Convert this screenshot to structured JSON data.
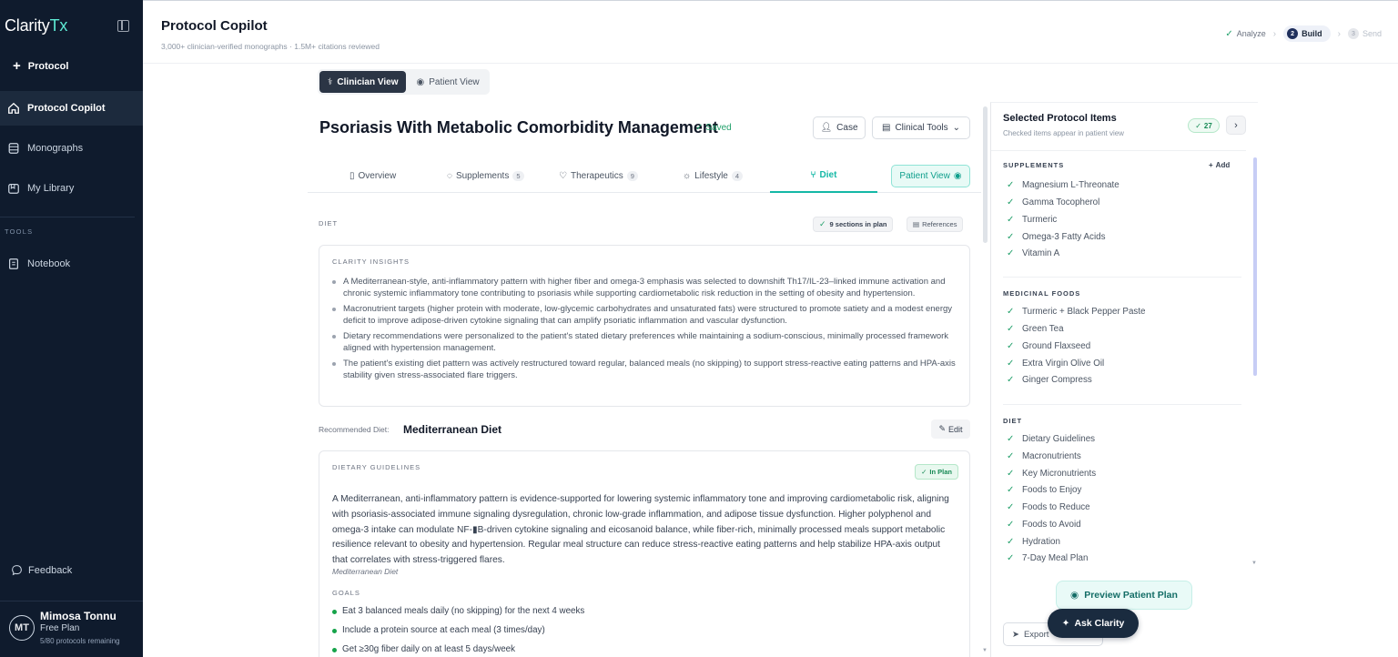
{
  "app": {
    "brand_main": "Clarity",
    "brand_accent": "Tx",
    "colors": {
      "sidebar": "#0f1b2d",
      "accent": "#14b8a6",
      "success": "#22a06b"
    }
  },
  "sidebar": {
    "new_protocol": "Protocol",
    "nav": [
      {
        "label": "Protocol Copilot",
        "icon": "home-icon"
      },
      {
        "label": "Monographs",
        "icon": "database-icon"
      },
      {
        "label": "My Library",
        "icon": "library-icon"
      }
    ],
    "tools_label": "TOOLS",
    "tools": [
      {
        "label": "Notebook",
        "icon": "notebook-icon"
      }
    ],
    "feedback": "Feedback",
    "user": {
      "initials": "MT",
      "name": "Mimosa Tonnu",
      "plan": "Free Plan",
      "remaining": "5/80 protocols remaining"
    }
  },
  "header": {
    "title": "Protocol Copilot",
    "subtitle": "3,000+ clinician-verified monographs · 1.5M+ citations reviewed",
    "steps": [
      {
        "label": "Analyze",
        "state": "done"
      },
      {
        "num": "2",
        "label": "Build",
        "state": "active"
      },
      {
        "num": "3",
        "label": "Send",
        "state": "disabled"
      }
    ]
  },
  "view_toggle": {
    "clinician": "Clinician View",
    "patient": "Patient View"
  },
  "protocol": {
    "title": "Psoriasis With Metabolic Comorbidity Management",
    "saved": "Saved",
    "case_btn": "Case",
    "tools_btn": "Clinical Tools",
    "tabs": [
      {
        "label": "Overview",
        "count": ""
      },
      {
        "label": "Supplements",
        "count": "5"
      },
      {
        "label": "Therapeutics",
        "count": "9"
      },
      {
        "label": "Lifestyle",
        "count": "4"
      },
      {
        "label": "Diet",
        "count": ""
      }
    ],
    "patient_view_btn": "Patient View"
  },
  "diet": {
    "section_label": "DIET",
    "sections_chip": "9 sections in plan",
    "references_chip": "References",
    "insights_heading": "CLARITY INSIGHTS",
    "insights": [
      "A Mediterranean-style, anti-inflammatory pattern with higher fiber and omega-3 emphasis was selected to downshift Th17/IL-23–linked immune activation and chronic systemic inflammatory tone contributing to psoriasis while supporting cardiometabolic risk reduction in the setting of obesity and hypertension.",
      "Macronutrient targets (higher protein with moderate, low-glycemic carbohydrates and unsaturated fats) were structured to promote satiety and a modest energy deficit to improve adipose-driven cytokine signaling that can amplify psoriatic inflammation and vascular dysfunction.",
      "Dietary recommendations were personalized to the patient's stated dietary preferences while maintaining a sodium-conscious, minimally processed framework aligned with hypertension management.",
      "The patient's existing diet pattern was actively restructured toward regular, balanced meals (no skipping) to support stress-reactive eating patterns and HPA-axis stability given stress-associated flare triggers."
    ],
    "recommended_label": "Recommended Diet:",
    "recommended_value": "Mediterranean Diet",
    "edit_btn": "Edit",
    "guidelines_heading": "DIETARY GUIDELINES",
    "in_plan": "In Plan",
    "guidelines_text": "A Mediterranean, anti-inflammatory pattern is evidence-supported for lowering systemic inflammatory tone and improving cardiometabolic risk, aligning with psoriasis-associated immune signaling dysregulation, chronic low-grade inflammation, and adipose tissue dysfunction. Higher polyphenol and omega-3 intake can modulate NF-▮B-driven cytokine signaling and eicosanoid balance, while fiber-rich, minimally processed meals support metabolic resilience relevant to obesity and hypertension. Regular meal structure can reduce stress-reactive eating patterns and help stabilize HPA-axis output that correlates with stress-triggered flares.",
    "guidelines_source": "Mediterranean Diet",
    "goals_heading": "GOALS",
    "goals": [
      "Eat 3 balanced meals daily (no skipping) for the next 4 weeks",
      "Include a protein source at each meal (3 times/day)",
      "Get ≥30g fiber daily on at least 5 days/week"
    ]
  },
  "panel": {
    "title": "Selected Protocol Items",
    "subtitle": "Checked items appear in patient view",
    "count": "27",
    "groups": [
      {
        "title": "SUPPLEMENTS",
        "add": "Add",
        "items": [
          "Magnesium L-Threonate",
          "Gamma Tocopherol",
          "Turmeric",
          "Omega-3 Fatty Acids",
          "Vitamin A"
        ]
      },
      {
        "title": "MEDICINAL FOODS",
        "items": [
          "Turmeric + Black Pepper Paste",
          "Green Tea",
          "Ground Flaxseed",
          "Extra Virgin Olive Oil",
          "Ginger Compress"
        ]
      },
      {
        "title": "DIET",
        "items": [
          "Dietary Guidelines",
          "Macronutrients",
          "Key Micronutrients",
          "Foods to Enjoy",
          "Foods to Reduce",
          "Foods to Avoid",
          "Hydration",
          "7-Day Meal Plan"
        ]
      }
    ],
    "preview_btn": "Preview Patient Plan",
    "export_btn": "Export",
    "ask_btn": "Ask Clarity"
  }
}
